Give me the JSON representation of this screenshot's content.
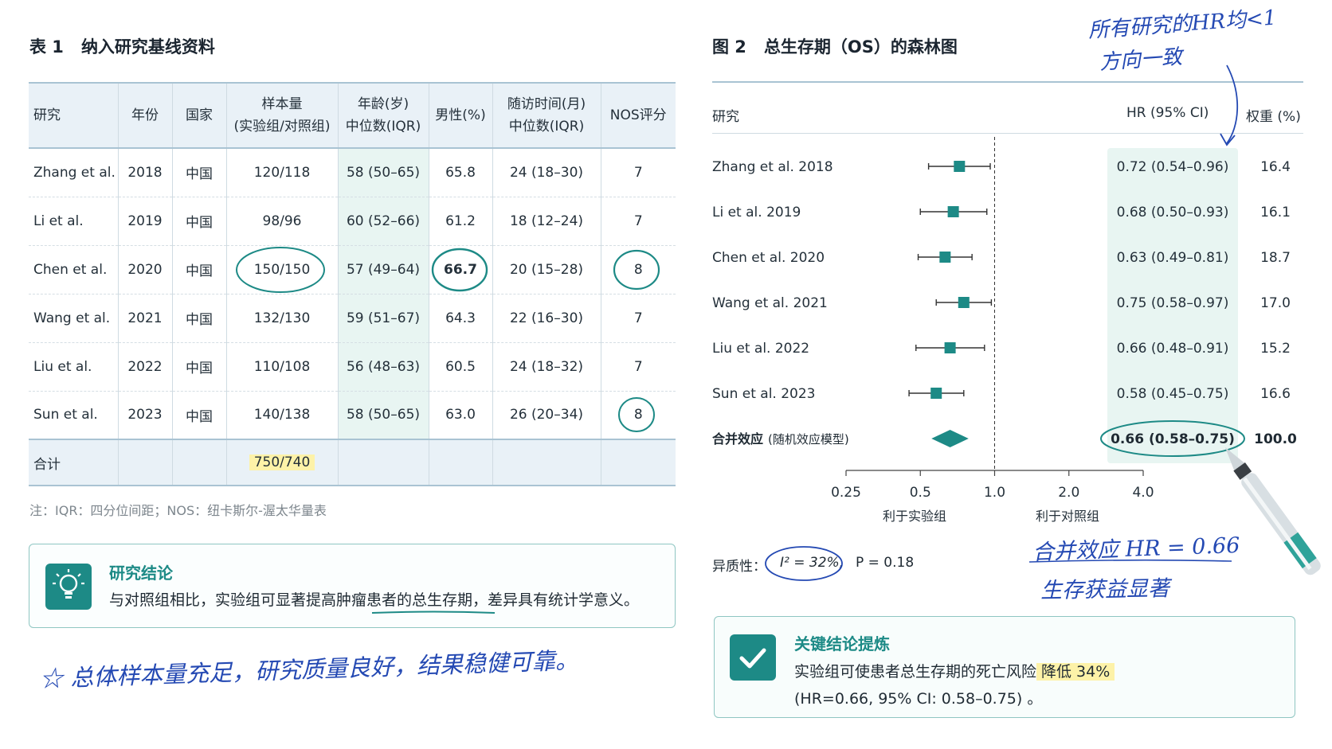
{
  "table1": {
    "title_num": "表 1",
    "title": "纳入研究基线资料",
    "headers": [
      {
        "l1": "研究",
        "l2": ""
      },
      {
        "l1": "年份",
        "l2": ""
      },
      {
        "l1": "国家",
        "l2": ""
      },
      {
        "l1": "样本量",
        "l2": "(实验组/对照组)"
      },
      {
        "l1": "年龄(岁)",
        "l2": "中位数(IQR)"
      },
      {
        "l1": "男性(%)",
        "l2": ""
      },
      {
        "l1": "随访时间(月)",
        "l2": "中位数(IQR)"
      },
      {
        "l1": "NOS评分",
        "l2": ""
      }
    ],
    "rows": [
      [
        "Zhang et al.",
        "2018",
        "中国",
        "120/118",
        "58 (50–65)",
        "65.8",
        "24 (18–30)",
        "7"
      ],
      [
        "Li et al.",
        "2019",
        "中国",
        "98/96",
        "60 (52–66)",
        "61.2",
        "18 (12–24)",
        "7"
      ],
      [
        "Chen et al.",
        "2020",
        "中国",
        "150/150",
        "57 (49–64)",
        "66.7",
        "20 (15–28)",
        "8"
      ],
      [
        "Wang et al.",
        "2021",
        "中国",
        "132/130",
        "59 (51–67)",
        "64.3",
        "22 (16–30)",
        "7"
      ],
      [
        "Liu et al.",
        "2022",
        "中国",
        "110/108",
        "56 (48–63)",
        "60.5",
        "24 (18–32)",
        "7"
      ],
      [
        "Sun et al.",
        "2023",
        "中国",
        "140/138",
        "58 (50–65)",
        "63.0",
        "26 (20–34)",
        "8"
      ]
    ],
    "total_label": "合计",
    "total_sample": "750/740",
    "note": "注：IQR：四分位间距；NOS：纽卡斯尔-渥太华量表"
  },
  "conclusion": {
    "heading": "研究结论",
    "text": "与对照组相比，实验组可显著提高肿瘤患者的总生存期，差异具有统计学意义。"
  },
  "handwriting": {
    "bottom_left": "☆ 总体样本量充足，研究质量良好，结果稳健可靠。",
    "top_right_1": "所有研究的HR均<1",
    "top_right_2": "方向一致",
    "right_mid_1": "合并效应 HR = 0.66",
    "right_mid_2": "生存获益显著"
  },
  "figure2": {
    "title_num": "图 2",
    "title": "总生存期（OS）的森林图",
    "col_study": "研究",
    "col_hr": "HR (95% CI)",
    "col_weight": "权重 (%)",
    "pooled_label": "合并效应",
    "pooled_sub": "(随机效应模型)",
    "left_favor": "利于实验组",
    "right_favor": "利于对照组",
    "heterogeneity_label": "异质性：",
    "i2_text": "I² = 32%,",
    "p_text": "P = 0.18"
  },
  "chart_data": {
    "type": "forest",
    "x_scale": "log",
    "xlim": [
      0.25,
      4.0
    ],
    "ticks": [
      "0.25",
      "0.5",
      "1.0",
      "2.0",
      "4.0"
    ],
    "tick_values": [
      0.25,
      0.5,
      1.0,
      2.0,
      4.0
    ],
    "reference_line": 1.0,
    "studies": [
      {
        "name": "Zhang et al. 2018",
        "hr": 0.72,
        "lo": 0.54,
        "hi": 0.96,
        "ci_text": "0.72 (0.54–0.96)",
        "weight": "16.4"
      },
      {
        "name": "Li et al. 2019",
        "hr": 0.68,
        "lo": 0.5,
        "hi": 0.93,
        "ci_text": "0.68 (0.50–0.93)",
        "weight": "16.1"
      },
      {
        "name": "Chen et al. 2020",
        "hr": 0.63,
        "lo": 0.49,
        "hi": 0.81,
        "ci_text": "0.63 (0.49–0.81)",
        "weight": "18.7"
      },
      {
        "name": "Wang et al. 2021",
        "hr": 0.75,
        "lo": 0.58,
        "hi": 0.97,
        "ci_text": "0.75 (0.58–0.97)",
        "weight": "17.0"
      },
      {
        "name": "Liu et al. 2022",
        "hr": 0.66,
        "lo": 0.48,
        "hi": 0.91,
        "ci_text": "0.66 (0.48–0.91)",
        "weight": "15.2"
      },
      {
        "name": "Sun et al. 2023",
        "hr": 0.58,
        "lo": 0.45,
        "hi": 0.75,
        "ci_text": "0.58 (0.45–0.75)",
        "weight": "16.6"
      }
    ],
    "pooled": {
      "hr": 0.66,
      "lo": 0.58,
      "hi": 0.75,
      "ci_text": "0.66 (0.58–0.75)",
      "weight": "100.0"
    }
  },
  "key_conclusion": {
    "heading": "关键结论提炼",
    "line1_prefix": "实验组可使患者总生存期的死亡风险",
    "line1_highlight": "降低 34%",
    "line2": "(HR=0.66, 95% CI: 0.58–0.75) 。"
  },
  "colors": {
    "teal": "#1d8a86",
    "hand_blue": "#2449b3",
    "highlight_yellow": "#fdf2a8",
    "band_green": "#e8f5f2"
  }
}
